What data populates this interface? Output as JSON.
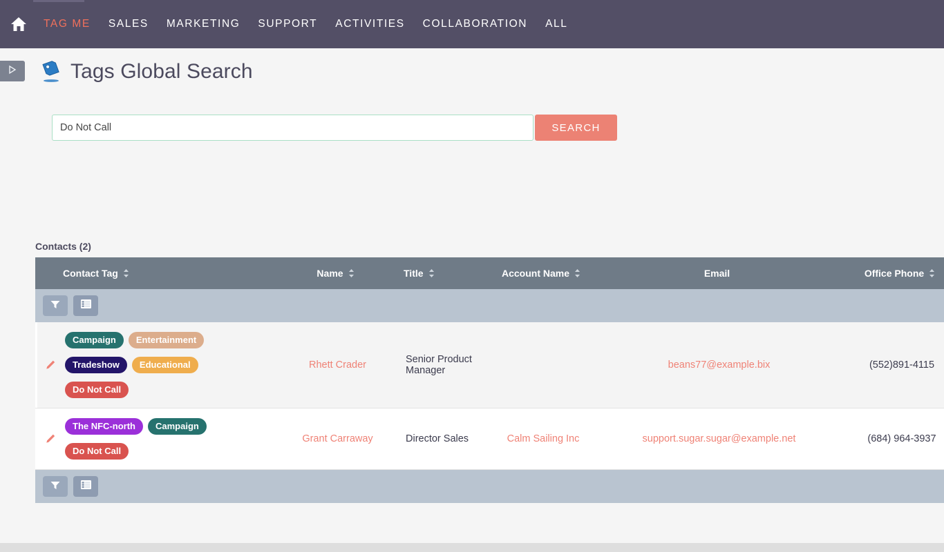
{
  "topnav": {
    "home_icon": "home-icon",
    "items": [
      {
        "label": "TAG ME",
        "active": true
      },
      {
        "label": "SALES",
        "active": false
      },
      {
        "label": "MARKETING",
        "active": false
      },
      {
        "label": "SUPPORT",
        "active": false
      },
      {
        "label": "ACTIVITIES",
        "active": false
      },
      {
        "label": "COLLABORATION",
        "active": false
      },
      {
        "label": "ALL",
        "active": false
      }
    ],
    "background_color": "#534f66",
    "active_color": "#f0705c"
  },
  "header": {
    "sidebar_toggle_icon": "triangle-right-icon",
    "page_icon": "tag-icon",
    "title": "Tags Global Search"
  },
  "search": {
    "value": "Do Not Call",
    "placeholder": "",
    "button_label": "SEARCH",
    "button_color": "#ec8274",
    "border_color": "#a9dfc5"
  },
  "results": {
    "label": "Contacts (2)",
    "columns": [
      {
        "key": "contact_tag",
        "label": "Contact Tag",
        "sortable": true
      },
      {
        "key": "name",
        "label": "Name",
        "sortable": true
      },
      {
        "key": "title",
        "label": "Title",
        "sortable": true
      },
      {
        "key": "account_name",
        "label": "Account Name",
        "sortable": true
      },
      {
        "key": "email",
        "label": "Email",
        "sortable": false
      },
      {
        "key": "office_phone",
        "label": "Office Phone",
        "sortable": true
      }
    ],
    "toolbar": {
      "filter_icon": "funnel-icon",
      "columns_icon": "list-view-icon"
    },
    "rows": [
      {
        "edit_icon": "pencil-icon",
        "tags": [
          {
            "label": "Campaign",
            "color": "#26726e"
          },
          {
            "label": "Entertainment",
            "color": "#dcad8c"
          },
          {
            "label": "Tradeshow",
            "color": "#231569"
          },
          {
            "label": "Educational",
            "color": "#efad4d"
          },
          {
            "label": "Do Not Call",
            "color": "#d9534f"
          }
        ],
        "tag_rows": [
          2,
          2,
          1
        ],
        "name": "Rhett Crader",
        "title": "Senior Product Manager",
        "account_name": "",
        "email": "beans77@example.bix",
        "office_phone": "(552)891-4115"
      },
      {
        "edit_icon": "pencil-icon",
        "tags": [
          {
            "label": "The NFC-north",
            "color": "#9b30d9"
          },
          {
            "label": "Campaign",
            "color": "#26726e"
          },
          {
            "label": "Do Not Call",
            "color": "#d9534f"
          }
        ],
        "tag_rows": [
          2,
          1
        ],
        "name": "Grant Carraway",
        "title": "Director Sales",
        "account_name": "Calm Sailing Inc",
        "email": "support.sugar.sugar@example.net",
        "office_phone": "(684) 964-3937"
      }
    ],
    "footer_toolbar": {
      "filter_icon": "funnel-icon",
      "columns_icon": "list-view-icon"
    }
  }
}
